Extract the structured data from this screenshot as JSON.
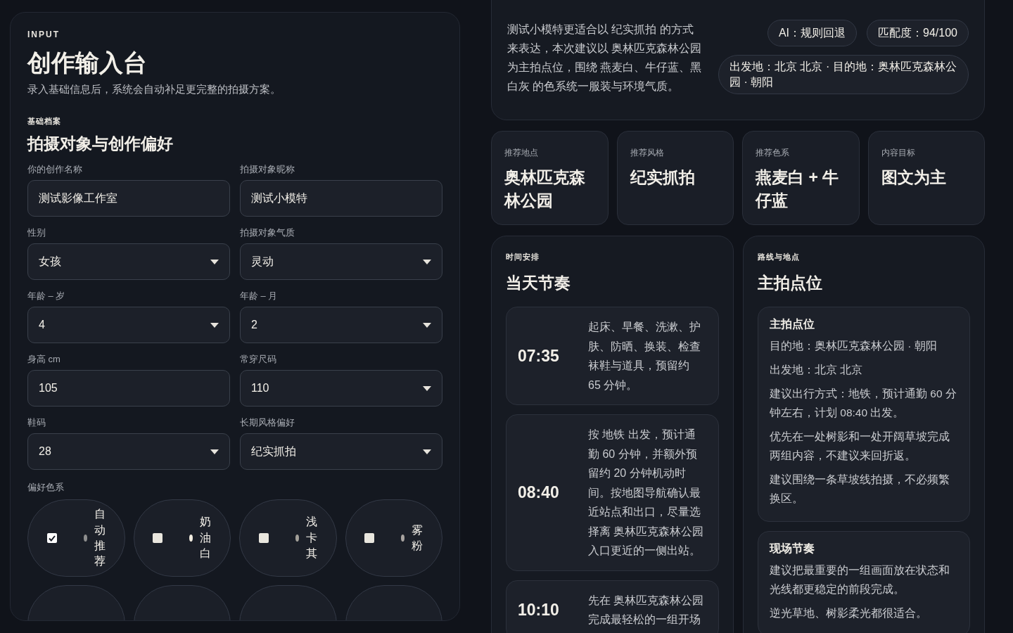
{
  "input_panel": {
    "eyebrow": "INPUT",
    "title": "创作输入台",
    "subtitle": "录入基础信息后，系统会自动补足更完整的拍摄方案。",
    "section_label": "基础档案",
    "section_title": "拍摄对象与创作偏好",
    "fields": [
      {
        "label": "你的创作名称",
        "kind": "text",
        "value": "测试影像工作室"
      },
      {
        "label": "拍摄对象昵称",
        "kind": "text",
        "value": "测试小模特"
      },
      {
        "label": "性别",
        "kind": "select",
        "value": "女孩"
      },
      {
        "label": "拍摄对象气质",
        "kind": "select",
        "value": "灵动"
      },
      {
        "label": "年龄 – 岁",
        "kind": "select",
        "value": "4"
      },
      {
        "label": "年龄 – 月",
        "kind": "select",
        "value": "2"
      },
      {
        "label": "身高 cm",
        "kind": "text",
        "value": "105"
      },
      {
        "label": "常穿尺码",
        "kind": "select",
        "value": "110"
      },
      {
        "label": "鞋码",
        "kind": "select",
        "value": "28"
      },
      {
        "label": "长期风格偏好",
        "kind": "select",
        "value": "纪实抓拍"
      }
    ],
    "color_label": "偏好色系",
    "color_options": [
      {
        "kind": "full",
        "label": "自动推荐",
        "checked": true,
        "color": "#8e8e8e"
      },
      {
        "kind": "full",
        "label": "奶油白",
        "checked": false,
        "color": "#f1ece0"
      },
      {
        "kind": "full",
        "label": "浅卡其",
        "checked": false,
        "color": "#a3a099"
      },
      {
        "kind": "full",
        "label": "雾粉",
        "checked": false,
        "color": "#a8a3a0"
      },
      {
        "kind": "blank"
      },
      {
        "kind": "blank"
      },
      {
        "kind": "blank"
      },
      {
        "kind": "blank"
      }
    ]
  },
  "plan": {
    "summary": "测试小模特更适合以 纪实抓拍 的方式来表达，本次建议以 奥林匹克森林公园为主拍点位，围绕 燕麦白、牛仔蓝、黑白灰 的色系统一服装与环境气质。",
    "badges": [
      "AI：规则回退",
      "匹配度：94/100"
    ],
    "route_badge": "出发地：北京 北京 · 目的地：奥林匹克森林公园 · 朝阳",
    "highlights": [
      {
        "label": "推荐地点",
        "value": "奥林匹克森林公园"
      },
      {
        "label": "推荐风格",
        "value": "纪实抓拍"
      },
      {
        "label": "推荐色系",
        "value": "燕麦白 + 牛仔蓝"
      },
      {
        "label": "内容目标",
        "value": "图文为主"
      }
    ],
    "schedule": {
      "label": "时间安排",
      "title": "当天节奏",
      "items": [
        {
          "time": "07:35",
          "text": "起床、早餐、洗漱、护肤、防晒、换装、检查袜鞋与道具，预留约 65 分钟。"
        },
        {
          "time": "08:40",
          "text": "按 地铁 出发，预计通勤 60 分钟，并额外预留约 20 分钟机动时间。按地图导航确认最近站点和出口，尽量选择离 奥林匹克森林公园入口更近的一侧出站。"
        },
        {
          "time": "10:10",
          "text": "先在 奥林匹克森林公园完成最轻松的一组开场"
        }
      ]
    },
    "route": {
      "label": "路线与地点",
      "title": "主拍点位",
      "blocks": [
        {
          "title": "主拍点位",
          "lines": [
            "目的地：奥林匹克森林公园 · 朝阳",
            "出发地：北京 北京",
            "建议出行方式：地铁，预计通勤 60 分钟左右，计划 08:40 出发。",
            "优先在一处树影和一处开阔草坡完成两组内容，不建议来回折返。",
            "建议围绕一条草坡线拍摄，不必频繁换区。"
          ]
        },
        {
          "title": "现场节奏",
          "lines": [
            "建议把最重要的一组画面放在状态和光线都更稳定的前段完成。",
            "逆光草地、树影柔光都很适合。"
          ]
        }
      ]
    }
  }
}
